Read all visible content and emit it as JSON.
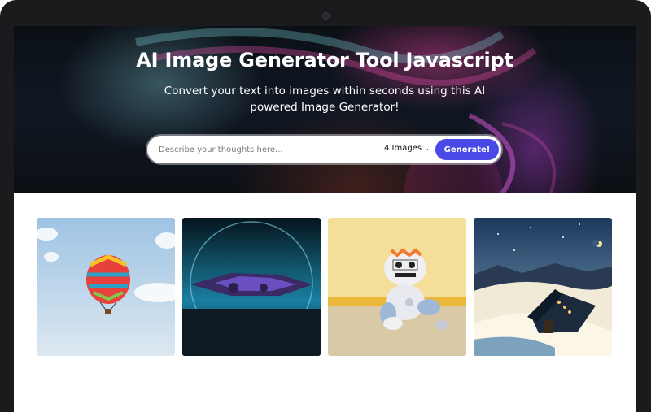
{
  "hero": {
    "title": "AI Image Generator Tool Javascript",
    "subtitle": "Convert your text into images within seconds using this AI powered Image Generator!"
  },
  "prompt_form": {
    "placeholder": "Describe your thoughts here...",
    "image_count": "4 Images",
    "generate_label": "Generate!"
  },
  "gallery": {
    "images": [
      {
        "subject": "hot-air-balloon"
      },
      {
        "subject": "spaceship"
      },
      {
        "subject": "robot-plush"
      },
      {
        "subject": "snowy-cabin-night"
      }
    ]
  },
  "colors": {
    "accent": "#4949e7",
    "hero_bg": "#0b1016"
  }
}
